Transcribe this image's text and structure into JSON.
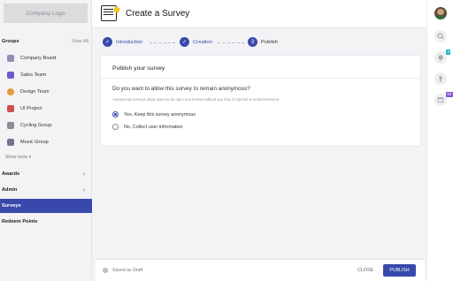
{
  "sidebar": {
    "logo": "Company Logo",
    "groups_title": "Groups",
    "view_all": "View All",
    "groups": [
      {
        "label": "Company Board",
        "color": "#8e8fb5"
      },
      {
        "label": "Sales Team",
        "color": "#6a5acd"
      },
      {
        "label": "Design Team",
        "color": "#e59b3a"
      },
      {
        "label": "UI Project",
        "color": "#d04f4f"
      },
      {
        "label": "Cycling Group",
        "color": "#8a8d96"
      },
      {
        "label": "Music Group",
        "color": "#7b6f8f"
      }
    ],
    "show_more": "Show more ▾",
    "nav": [
      {
        "label": "Awards",
        "chevron": "›"
      },
      {
        "label": "Admin",
        "chevron": "›"
      },
      {
        "label": "Surveys",
        "chevron": ""
      },
      {
        "label": "Redeem Points",
        "chevron": ""
      }
    ]
  },
  "header": {
    "icon": "survey-clipboard-icon",
    "title": "Create a Survey"
  },
  "stepper": {
    "steps": [
      {
        "label": "Introduction",
        "marker": "✓",
        "state": "done"
      },
      {
        "label": "Creation",
        "marker": "✓",
        "state": "done"
      },
      {
        "label": "Publish",
        "marker": "3",
        "state": "current"
      }
    ]
  },
  "card": {
    "title": "Publish your survey",
    "question": "Do you want to allow this survey to remain anonymous?",
    "hint": "Anonymous surveys allow users to be open and honest without any fear of reprisal or embarrassment.",
    "options": [
      {
        "label": "Yes, Keep this survey anonymous",
        "selected": true
      },
      {
        "label": "No, Collect user information",
        "selected": false
      }
    ]
  },
  "footer": {
    "status": "Saved as Draft",
    "close_label": "CLOSE",
    "publish_label": "PUBLISH"
  },
  "rail": {
    "notifications_badge": "3",
    "tasks_badge": "63"
  },
  "colors": {
    "accent": "#3949ab",
    "badge_teal": "#19b5c6",
    "badge_purple": "#8a4fd8"
  }
}
